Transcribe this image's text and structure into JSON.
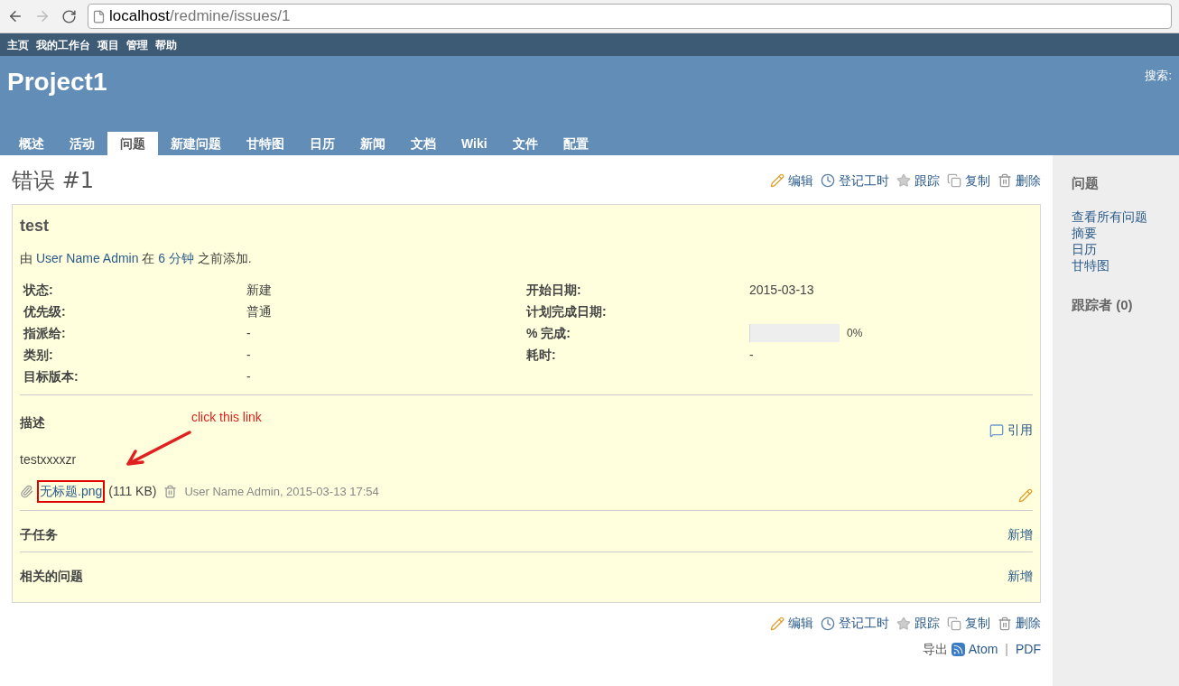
{
  "browser": {
    "url_host": "localhost",
    "url_path": "/redmine/issues/1"
  },
  "top_menu": [
    "主页",
    "我的工作台",
    "项目",
    "管理",
    "帮助"
  ],
  "header": {
    "project": "Project1",
    "search_label": "搜索:"
  },
  "tabs": [
    {
      "label": "概述",
      "selected": false
    },
    {
      "label": "活动",
      "selected": false
    },
    {
      "label": "问题",
      "selected": true
    },
    {
      "label": "新建问题",
      "selected": false
    },
    {
      "label": "甘特图",
      "selected": false
    },
    {
      "label": "日历",
      "selected": false
    },
    {
      "label": "新闻",
      "selected": false
    },
    {
      "label": "文档",
      "selected": false
    },
    {
      "label": "Wiki",
      "selected": false
    },
    {
      "label": "文件",
      "selected": false
    },
    {
      "label": "配置",
      "selected": false
    }
  ],
  "issue": {
    "title": "错误 #1",
    "actions": [
      {
        "kind": "edit",
        "label": "编辑"
      },
      {
        "kind": "log",
        "label": "登记工时"
      },
      {
        "kind": "watch",
        "label": "跟踪"
      },
      {
        "kind": "copy",
        "label": "复制"
      },
      {
        "kind": "delete",
        "label": "删除"
      }
    ],
    "subject": "test",
    "author_line": {
      "prefix": "由",
      "author": "User Name Admin",
      "middle": "在",
      "age": "6 分钟",
      "suffix": "之前添加."
    },
    "attributes_left": [
      {
        "label": "状态:",
        "value": "新建"
      },
      {
        "label": "优先级:",
        "value": "普通"
      },
      {
        "label": "指派给:",
        "value": "-"
      },
      {
        "label": "类别:",
        "value": "-"
      },
      {
        "label": "目标版本:",
        "value": "-"
      }
    ],
    "attributes_right": [
      {
        "kind": "text",
        "label": "开始日期:",
        "value": "2015-03-13"
      },
      {
        "kind": "text",
        "label": "计划完成日期:"
      },
      {
        "kind": "progress",
        "label": "% 完成:",
        "level": 0,
        "reading": "0%"
      },
      {
        "kind": "text",
        "label": "耗时:",
        "value": "-"
      }
    ],
    "description": {
      "heading": "描述",
      "quote": "引用",
      "text": "testxxxxzr",
      "annotation": "click this link"
    },
    "attachment": {
      "filename": "无标题.png",
      "size": "(111 KB)",
      "meta": "User Name Admin, 2015-03-13 17:54"
    },
    "subtasks": {
      "heading": "子任务",
      "add": "新增"
    },
    "relations": {
      "heading": "相关的问题",
      "add": "新增"
    }
  },
  "bottom_actions": [
    {
      "kind": "edit",
      "label": "编辑"
    },
    {
      "kind": "log",
      "label": "登记工时"
    },
    {
      "kind": "watch",
      "label": "跟踪"
    },
    {
      "kind": "copy",
      "label": "复制"
    },
    {
      "kind": "delete",
      "label": "删除"
    }
  ],
  "export": {
    "label": "导出",
    "links": [
      "Atom",
      "PDF"
    ],
    "separator": "|"
  },
  "sidebar": {
    "heading": "问题",
    "links": [
      "查看所有问题",
      "摘要",
      "日历",
      "甘特图"
    ],
    "watchers": "跟踪者 (0)"
  }
}
